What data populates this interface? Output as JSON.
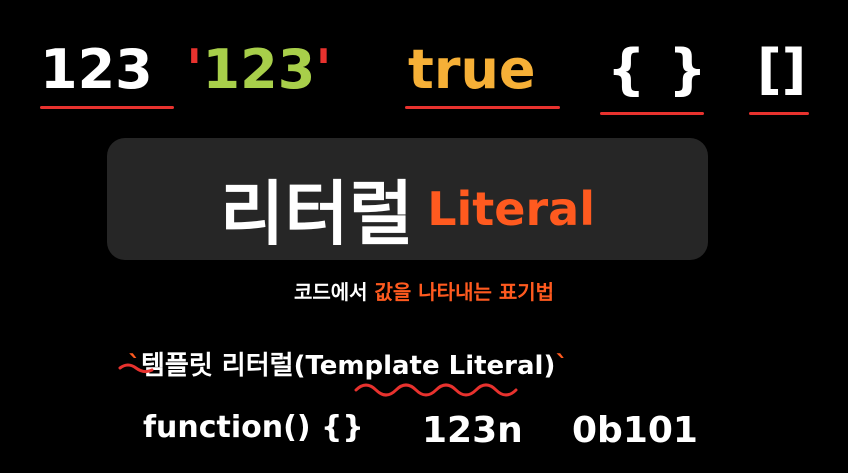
{
  "colors": {
    "white": "#ffffff",
    "red": "#e8322e",
    "green": "#a8cf4a",
    "orange": "#f6b037",
    "orange_red": "#ff5a1f",
    "card_bg": "#262626"
  },
  "literals": {
    "number": "123",
    "string_quote_open": "'",
    "string_value": "123",
    "string_quote_close": "'",
    "boolean": "true",
    "object": "{ }",
    "array": "[]"
  },
  "title": {
    "korean": "리터럴",
    "english": "Literal"
  },
  "subtitle": {
    "prefix": "코드에서 ",
    "highlight": "값을 나타내는 표기법"
  },
  "template_literal": {
    "backtick_open": "`",
    "text": "템플릿 리터럴(Template Literal)",
    "backtick_close": "`"
  },
  "examples": {
    "function": "function() {}",
    "bigint": "123n",
    "binary": "0b101"
  }
}
